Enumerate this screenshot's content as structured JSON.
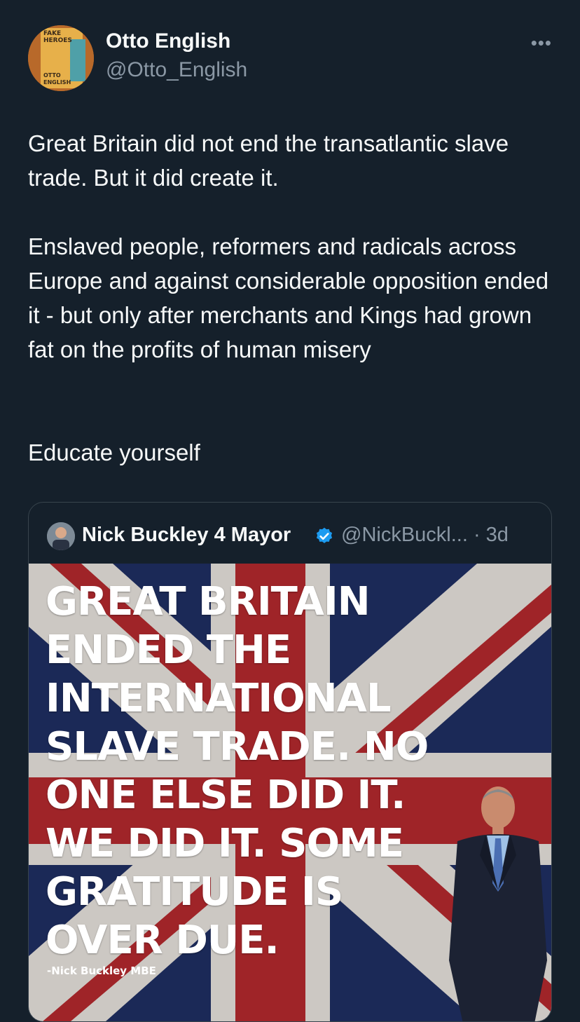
{
  "author": {
    "name": "Otto English",
    "handle": "@Otto_English",
    "avatar_text": [
      "FAKE",
      "HEROES",
      "OTTO",
      "ENGLISH"
    ]
  },
  "more_label": "•••",
  "tweet": {
    "paragraph1": "Great Britain did not end the transatlantic slave trade. But it did create it.",
    "paragraph2": "Enslaved people, reformers and radicals across Europe and against considerable opposition ended it - but only after merchants and Kings had grown fat on the profits of human misery",
    "paragraph3": "Educate yourself"
  },
  "quoted": {
    "name": "Nick Buckley 4 Mayor",
    "handle_time": "@NickBuckl... · 3d",
    "image": {
      "lines": [
        "GREAT BRITAIN",
        "ENDED THE",
        "INTERNATIONAL",
        "SLAVE TRADE. NO",
        "ONE ELSE DID IT.",
        "WE DID IT. SOME",
        "GRATITUDE IS",
        "OVER DUE."
      ],
      "attribution": "-Nick Buckley MBE"
    }
  },
  "colors": {
    "background": "#15202b",
    "text": "#f7f9f9",
    "secondary": "#8b98a5",
    "border": "#38444d",
    "verified": "#1d9bf0",
    "flag_blue": "#1f2f63",
    "flag_red": "#b52a2e"
  }
}
